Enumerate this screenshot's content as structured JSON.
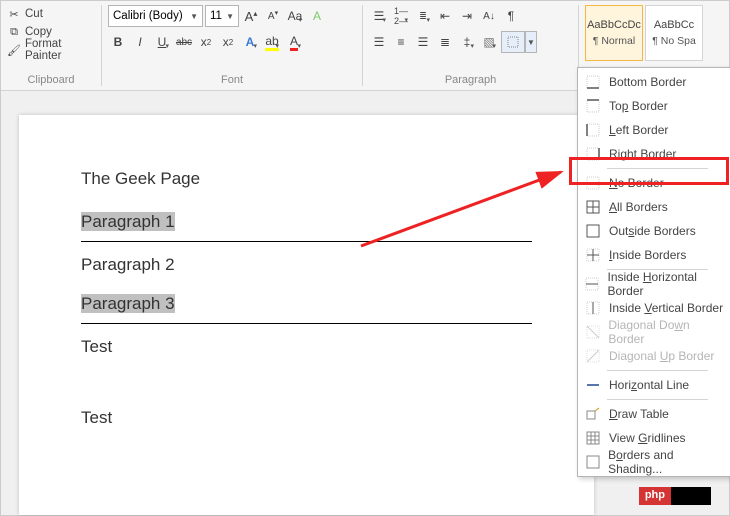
{
  "clipboard": {
    "cut": "Cut",
    "copy": "Copy",
    "format": "Format Painter",
    "label": "Clipboard"
  },
  "font": {
    "name": "Calibri (Body)",
    "size": "11",
    "label": "Font",
    "bold": "B",
    "italic": "I",
    "underline": "U",
    "strike": "abc",
    "sub": "x",
    "sup": "x",
    "aa": "Aa",
    "growA": "A",
    "shrinkA": "A",
    "clear": "A"
  },
  "paragraph": {
    "label": "Paragraph"
  },
  "styles": {
    "preview": "AaBbCcDc",
    "normal": "¶ Normal",
    "preview2": "AaBbCc",
    "nospac": "¶ No Spa"
  },
  "border_menu": {
    "bottom": "Bottom Border",
    "top_pre": "To",
    "top_u": "p",
    "top_post": " Border",
    "left_u": "L",
    "left_post": "eft Border",
    "right_u": "R",
    "right_post": "ight Border",
    "no_u": "N",
    "no_post": "o Border",
    "all_u": "A",
    "all_post": "ll Borders",
    "outside": "Out",
    "outside_u": "s",
    "outside_post": "ide Borders",
    "inside_u": "I",
    "inside_post": "nside Borders",
    "ih_pre": "Inside ",
    "ih_u": "H",
    "ih_post": "orizontal Border",
    "iv_pre": "Inside ",
    "iv_u": "V",
    "iv_post": "ertical Border",
    "dd_pre": "Diagonal Do",
    "dd_u": "w",
    "dd_post": "n Border",
    "du_pre": "Diagonal ",
    "du_u": "U",
    "du_post": "p Border",
    "hline": "Hori",
    "hline_u": "z",
    "hline_post": "ontal Line",
    "draw_u": "D",
    "draw_post": "raw Table",
    "grid_pre": "View ",
    "grid_u": "G",
    "grid_post": "ridlines",
    "bs_pre": "B",
    "bs_u": "o",
    "bs_post": "rders and Shading..."
  },
  "document": {
    "title": "The Geek Page",
    "p1": "Paragraph 1",
    "p2": "Paragraph 2",
    "p3": "Paragraph 3",
    "t1": "Test",
    "t2": "Test"
  },
  "badge": {
    "left": "php",
    "right": ""
  }
}
